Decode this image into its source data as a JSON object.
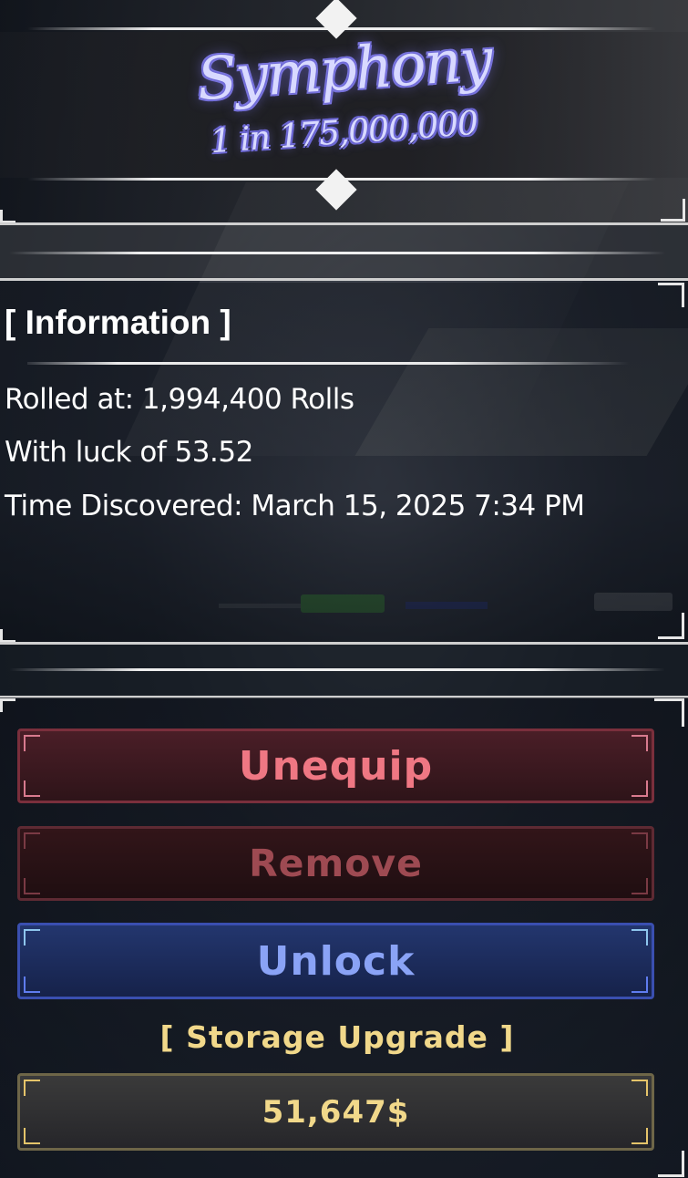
{
  "aura": {
    "name": "Symphony",
    "rarity": "1 in 175,000,000"
  },
  "info": {
    "heading": "[ Information ]",
    "rolled_at": "Rolled at: 1,994,400 Rolls",
    "luck": "With luck of 53.52",
    "discovered": "Time Discovered: March 15, 2025 7:34 PM"
  },
  "actions": {
    "unequip_label": "Unequip",
    "remove_label": "Remove",
    "unlock_label": "Unlock",
    "storage_label": "[ Storage Upgrade ]",
    "storage_price": "51,647$"
  },
  "colors": {
    "title_glow": "#7d78e0",
    "unequip": "#ef7783",
    "remove": "#9e4a52",
    "unlock": "#8aa3f6",
    "gold": "#f1d88a"
  }
}
